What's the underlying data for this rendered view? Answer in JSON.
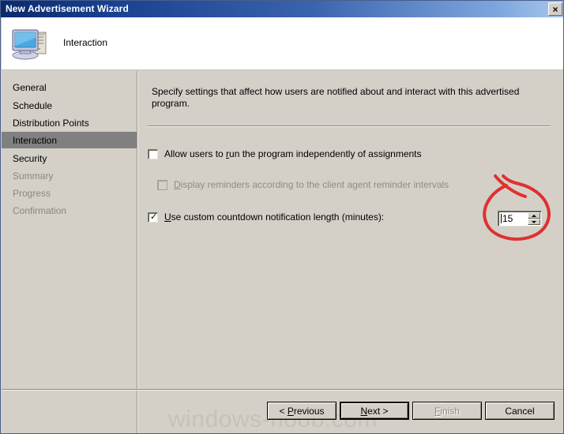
{
  "window": {
    "title": "New Advertisement Wizard",
    "close_label": "×"
  },
  "header": {
    "icon": "computer-icon",
    "title": "Interaction"
  },
  "sidebar": {
    "items": [
      {
        "label": "General",
        "state": "normal"
      },
      {
        "label": "Schedule",
        "state": "normal"
      },
      {
        "label": "Distribution Points",
        "state": "normal"
      },
      {
        "label": "Interaction",
        "state": "selected"
      },
      {
        "label": "Security",
        "state": "normal"
      },
      {
        "label": "Summary",
        "state": "disabled"
      },
      {
        "label": "Progress",
        "state": "disabled"
      },
      {
        "label": "Confirmation",
        "state": "disabled"
      }
    ]
  },
  "content": {
    "intro": "Specify settings that affect how users are notified about and interact with this advertised program.",
    "checkbox_allow_run": {
      "label_before": "Allow users to ",
      "label_accel": "r",
      "label_after": "un the program independently of assignments",
      "checked": false,
      "enabled": true
    },
    "checkbox_display_reminders": {
      "label_before": "",
      "label_accel": "D",
      "label_after": "isplay reminders according to the client agent reminder intervals",
      "checked": false,
      "enabled": false
    },
    "checkbox_custom_countdown": {
      "label_before": "",
      "label_accel": "U",
      "label_after": "se custom countdown notification length (minutes):",
      "checked": true,
      "enabled": true
    },
    "countdown_spinner": {
      "value": "15",
      "up_icon": "spinner-up-arrow-icon",
      "down_icon": "spinner-down-arrow-icon"
    }
  },
  "footer": {
    "previous": {
      "label": "< Previous",
      "accel": "P",
      "enabled": true,
      "default": false
    },
    "next": {
      "label": "Next >",
      "accel": "N",
      "enabled": true,
      "default": true
    },
    "finish": {
      "label": "Finish",
      "accel": "F",
      "enabled": false,
      "default": false
    },
    "cancel": {
      "label": "Cancel",
      "accel": "",
      "enabled": true,
      "default": false
    }
  },
  "watermark": {
    "text": "windows-noob.com"
  },
  "annotation": {
    "type": "red-circle-highlight",
    "color": "#e03030",
    "target": "countdown-spinner"
  },
  "colors": {
    "titlebar_start": "#0a2a6b",
    "titlebar_end": "#a8c6ec",
    "dialog_face": "#d4d0c8",
    "selected_nav": "#808080",
    "disabled_text": "#8a8779",
    "annotation_red": "#e03030",
    "watermark_gray": "#c6c2b8"
  }
}
